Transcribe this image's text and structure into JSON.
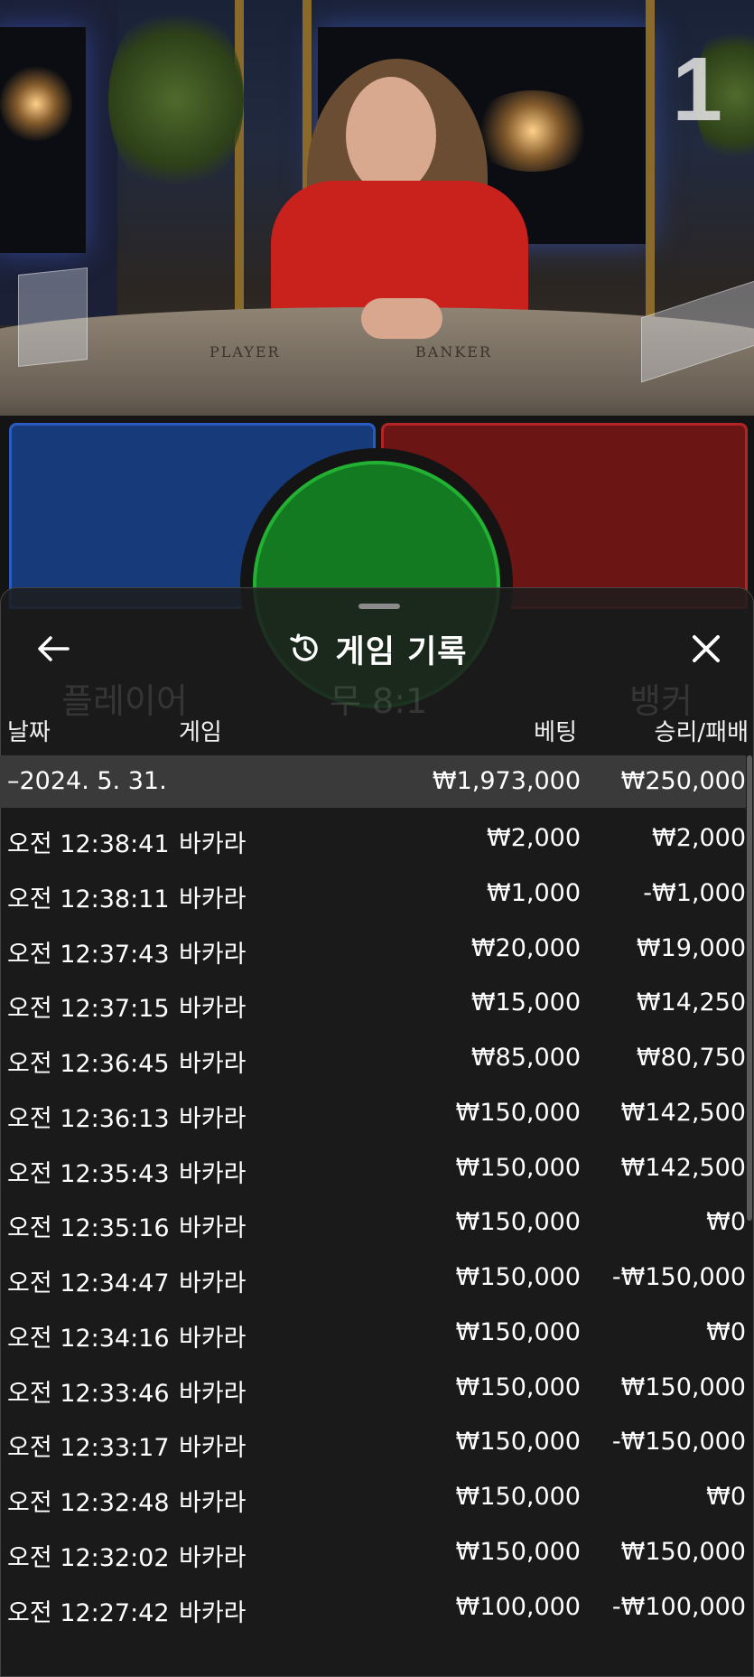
{
  "video": {
    "round_number": "1",
    "table_labels": {
      "player": "PLAYER",
      "banker": "BANKER"
    }
  },
  "background_hint": {
    "player_label": "플레이어",
    "tie_label": "무 8:1",
    "banker_label": "뱅커"
  },
  "sheet": {
    "title": "게임 기록",
    "icons": {
      "back": "arrow-left-icon",
      "history": "history-icon",
      "close": "close-icon"
    },
    "columns": {
      "date": "날짜",
      "game": "게임",
      "bet": "베팅",
      "win_loss": "승리/패배"
    },
    "date_group": {
      "date": "–2024. 5. 31.",
      "total_bet": "₩1,973,000",
      "total_win_loss": "₩250,000"
    },
    "rows": [
      {
        "time": "오전 12:38:41",
        "game": "바카라",
        "bet": "₩2,000",
        "result": "₩2,000"
      },
      {
        "time": "오전 12:38:11",
        "game": "바카라",
        "bet": "₩1,000",
        "result": "-₩1,000"
      },
      {
        "time": "오전 12:37:43",
        "game": "바카라",
        "bet": "₩20,000",
        "result": "₩19,000"
      },
      {
        "time": "오전 12:37:15",
        "game": "바카라",
        "bet": "₩15,000",
        "result": "₩14,250"
      },
      {
        "time": "오전 12:36:45",
        "game": "바카라",
        "bet": "₩85,000",
        "result": "₩80,750"
      },
      {
        "time": "오전 12:36:13",
        "game": "바카라",
        "bet": "₩150,000",
        "result": "₩142,500"
      },
      {
        "time": "오전 12:35:43",
        "game": "바카라",
        "bet": "₩150,000",
        "result": "₩142,500"
      },
      {
        "time": "오전 12:35:16",
        "game": "바카라",
        "bet": "₩150,000",
        "result": "₩0"
      },
      {
        "time": "오전 12:34:47",
        "game": "바카라",
        "bet": "₩150,000",
        "result": "-₩150,000"
      },
      {
        "time": "오전 12:34:16",
        "game": "바카라",
        "bet": "₩150,000",
        "result": "₩0"
      },
      {
        "time": "오전 12:33:46",
        "game": "바카라",
        "bet": "₩150,000",
        "result": "₩150,000"
      },
      {
        "time": "오전 12:33:17",
        "game": "바카라",
        "bet": "₩150,000",
        "result": "-₩150,000"
      },
      {
        "time": "오전 12:32:48",
        "game": "바카라",
        "bet": "₩150,000",
        "result": "₩0"
      },
      {
        "time": "오전 12:32:02",
        "game": "바카라",
        "bet": "₩150,000",
        "result": "₩150,000"
      },
      {
        "time": "오전 12:27:42",
        "game": "바카라",
        "bet": "₩100,000",
        "result": "-₩100,000"
      }
    ]
  },
  "colors": {
    "player_blue": "#173a7a",
    "banker_red": "#6c1515",
    "tie_green": "#147a22",
    "sheet_bg": "#1c1c1c",
    "date_row_bg": "#3a3a3a"
  }
}
